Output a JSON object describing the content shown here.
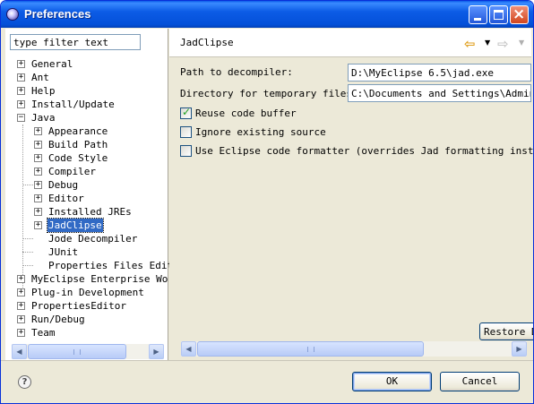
{
  "window": {
    "title": "Preferences"
  },
  "filter": {
    "placeholder": "type filter text"
  },
  "tree": {
    "general": "General",
    "ant": "Ant",
    "help": "Help",
    "install_update": "Install/Update",
    "java": "Java",
    "java_children": {
      "appearance": "Appearance",
      "build_path": "Build Path",
      "code_style": "Code Style",
      "compiler": "Compiler",
      "debug": "Debug",
      "editor": "Editor",
      "installed_jres": "Installed JREs",
      "jadclipse": "JadClipse",
      "jode_decompiler": "Jode Decompiler",
      "junit": "JUnit",
      "properties_files_editor": "Properties Files Edito"
    },
    "myeclipse": "MyEclipse Enterprise Work",
    "plugin_development": "Plug-in Development",
    "properties_editor": "PropertiesEditor",
    "run_debug": "Run/Debug",
    "team": "Team",
    "selected": "JadClipse"
  },
  "page": {
    "title": "JadClipse",
    "path_label": "Path to decompiler:",
    "path_value": "D:\\MyEclipse 6.5\\jad.exe",
    "tempdir_label": "Directory for temporary files:",
    "tempdir_value": "C:\\Documents and Settings\\Administ",
    "reuse_buffer_label": "Reuse code buffer",
    "reuse_buffer_checked": true,
    "ignore_source_label": "Ignore existing source",
    "ignore_source_checked": false,
    "eclipse_formatter_label": "Use Eclipse code formatter (overrides Jad formatting instructi",
    "eclipse_formatter_checked": false,
    "restore_label": "Restore D"
  },
  "buttons": {
    "ok": "OK",
    "cancel": "Cancel"
  },
  "icons": {
    "app": "eclipse-icon",
    "back": "back-arrow-icon",
    "forward": "forward-arrow-icon",
    "help": "help-icon"
  },
  "colors": {
    "selection": "#316ac5",
    "titlebar": "#0450d8",
    "window_bg": "#ece9d8"
  }
}
